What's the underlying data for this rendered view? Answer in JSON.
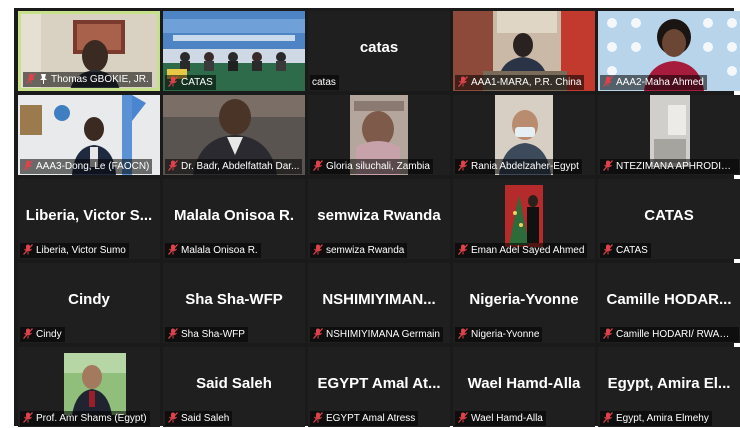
{
  "colors": {
    "tile_bg": "#1f1f1f",
    "active_border": "#c7e08a",
    "muted_mic": "#e0424b",
    "name_text": "#ffffff"
  },
  "icons": {
    "muted": "muted-microphone-icon",
    "pinned": "pin-icon"
  },
  "participants": [
    {
      "label": "Thomas GBOKIE, JR.",
      "big_name": "",
      "video": "person-office",
      "active": true,
      "pinned": true
    },
    {
      "label": "CATAS",
      "big_name": "",
      "video": "conference-stage",
      "active": false,
      "pinned": false
    },
    {
      "label": "catas",
      "big_name": "catas",
      "video": "",
      "active": false,
      "pinned": false,
      "unmuted": true
    },
    {
      "label": "AAA1-MARA, P.R. China",
      "big_name": "",
      "video": "person-flags",
      "active": false,
      "pinned": false
    },
    {
      "label": "AAA2-Maha Ahmed",
      "big_name": "",
      "video": "person-woman",
      "active": false,
      "pinned": false
    },
    {
      "label": "AAA3-Dong, Le (FAOCN)",
      "big_name": "",
      "video": "person-fao",
      "active": false,
      "pinned": false
    },
    {
      "label": "Dr. Badr, Abdelfattah Dar...",
      "big_name": "",
      "video": "person-suit",
      "active": false,
      "pinned": false
    },
    {
      "label": "Gloria siluchali, Zambia",
      "big_name": "",
      "video": "person-scarf",
      "active": false,
      "pinned": false
    },
    {
      "label": "Rania Abdelzaher-Egypt",
      "big_name": "",
      "video": "person-mask",
      "active": false,
      "pinned": false
    },
    {
      "label": "NTEZIMANA APHRODIS/...",
      "big_name": "",
      "video": "window-light",
      "active": false,
      "pinned": false
    },
    {
      "label": "Liberia, Victor Sumo",
      "big_name": "Liberia, Victor S...",
      "video": "",
      "active": false,
      "pinned": false
    },
    {
      "label": "Malala Onisoa R.",
      "big_name": "Malala Onisoa R.",
      "video": "",
      "active": false,
      "pinned": false
    },
    {
      "label": "semwiza Rwanda",
      "big_name": "semwiza Rwanda",
      "video": "",
      "active": false,
      "pinned": false
    },
    {
      "label": "Eman Adel Sayed Ahmed",
      "big_name": "",
      "video": "photo-christmas",
      "active": false,
      "pinned": false
    },
    {
      "label": "CATAS",
      "big_name": "CATAS",
      "video": "",
      "active": false,
      "pinned": false
    },
    {
      "label": "Cindy",
      "big_name": "Cindy",
      "video": "",
      "active": false,
      "pinned": false
    },
    {
      "label": "Sha Sha-WFP",
      "big_name": "Sha Sha-WFP",
      "video": "",
      "active": false,
      "pinned": false
    },
    {
      "label": "NSHIMIYIMANA Germain",
      "big_name": "NSHIMIYIMAN...",
      "video": "",
      "active": false,
      "pinned": false
    },
    {
      "label": "Nigeria-Yvonne",
      "big_name": "Nigeria-Yvonne",
      "video": "",
      "active": false,
      "pinned": false
    },
    {
      "label": "Camille HODARI/ RWANDA",
      "big_name": "Camille HODAR...",
      "video": "",
      "active": false,
      "pinned": false
    },
    {
      "label": "Prof. Amr Shams (Egypt)",
      "big_name": "",
      "video": "photo-portrait",
      "active": false,
      "pinned": false
    },
    {
      "label": "Said Saleh",
      "big_name": "Said Saleh",
      "video": "",
      "active": false,
      "pinned": false
    },
    {
      "label": "EGYPT  Amal Atress",
      "big_name": "EGYPT  Amal At...",
      "video": "",
      "active": false,
      "pinned": false
    },
    {
      "label": "Wael Hamd-Alla",
      "big_name": "Wael Hamd-Alla",
      "video": "",
      "active": false,
      "pinned": false
    },
    {
      "label": "Egypt, Amira Elmehy",
      "big_name": "Egypt, Amira El...",
      "video": "",
      "active": false,
      "pinned": false
    }
  ]
}
